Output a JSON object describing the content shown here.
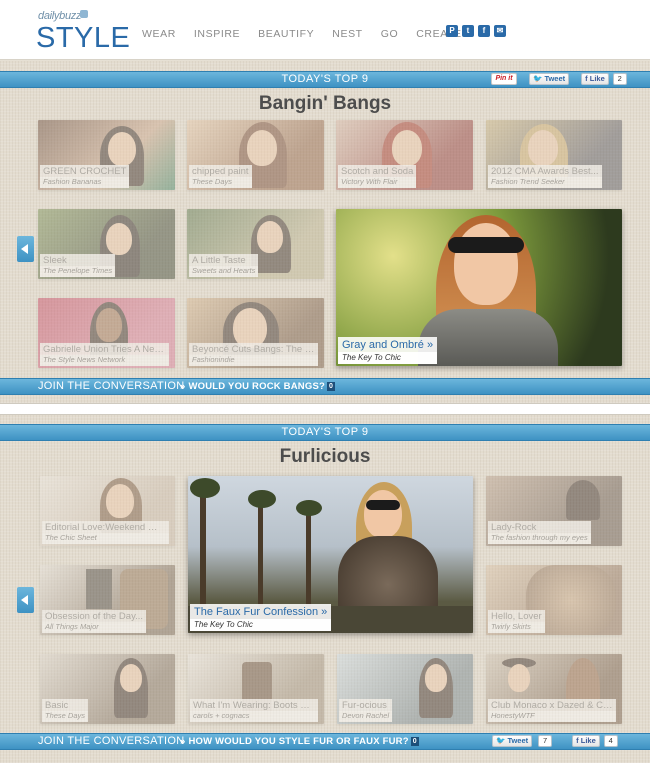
{
  "header": {
    "logo_small": "dailybuzz",
    "logo_big": "STYLE",
    "nav": [
      "WEAR",
      "INSPIRE",
      "BEAUTIFY",
      "NEST",
      "GO",
      "CREATE"
    ],
    "social_icons": [
      "pinterest-icon",
      "twitter-icon",
      "facebook-icon",
      "mail-icon"
    ]
  },
  "top": {
    "bar_title": "TODAY'S TOP 9",
    "heading": "Bangin' Bangs",
    "share": {
      "pin": "Pin it",
      "tweet": "Tweet",
      "like": "Like",
      "like_count": "2"
    },
    "tiles": [
      {
        "title": "GREEN CROCHET",
        "source": "Fashion Bananas"
      },
      {
        "title": "chipped paint",
        "source": "These Days"
      },
      {
        "title": "Scotch and Soda",
        "source": "Victory With Flair"
      },
      {
        "title": "2012 CMA Awards Best...",
        "source": "Fashion Trend Seeker"
      },
      {
        "title": "Sleek",
        "source": "The Penelope Times"
      },
      {
        "title": "A Little Taste",
        "source": "Sweets and Hearts"
      },
      {
        "title": "Gabrielle Union Tries A New...",
        "source": "The Style News Network"
      },
      {
        "title": "Beyoncé Cuts Bangs: The Best...",
        "source": "Fashionindie"
      },
      {
        "title": "Gray and Ombré »",
        "source": "The Key To Chic"
      }
    ],
    "join": "JOIN THE CONVERSATION",
    "question": "WOULD YOU ROCK BANGS?",
    "question_count": "0"
  },
  "bottom": {
    "bar_title": "TODAY'S TOP 9",
    "heading": "Furlicious",
    "tiles": [
      {
        "title": "Editorial Love:Weekend Wear",
        "source": "The Chic Sheet"
      },
      {
        "title": "The Faux Fur Confession »",
        "source": "The Key To Chic"
      },
      {
        "title": "Lady-Rock",
        "source": "The fashion through my eyes"
      },
      {
        "title": "Obsession of the Day...",
        "source": "All Things Major"
      },
      {
        "title": "Hello, Lover",
        "source": "Twirly Skirts"
      },
      {
        "title": "Basic",
        "source": "These Days"
      },
      {
        "title": "What I'm Wearing: Boots With...",
        "source": "carols + cognacs"
      },
      {
        "title": "Fur-ocious",
        "source": "Devon Rachel"
      },
      {
        "title": "Club Monaco x Dazed & Conf...",
        "source": "HonestyWTF"
      }
    ],
    "join": "JOIN THE CONVERSATION",
    "question": "HOW WOULD YOU STYLE FUR OR FAUX FUR?",
    "question_count": "0",
    "share": {
      "tweet": "Tweet",
      "tweet_count": "7",
      "like": "Like",
      "like_count": "4"
    }
  },
  "colors": {
    "accent": "#3e92c3",
    "brand": "#2a6aa8",
    "background": "#e3dccf"
  }
}
